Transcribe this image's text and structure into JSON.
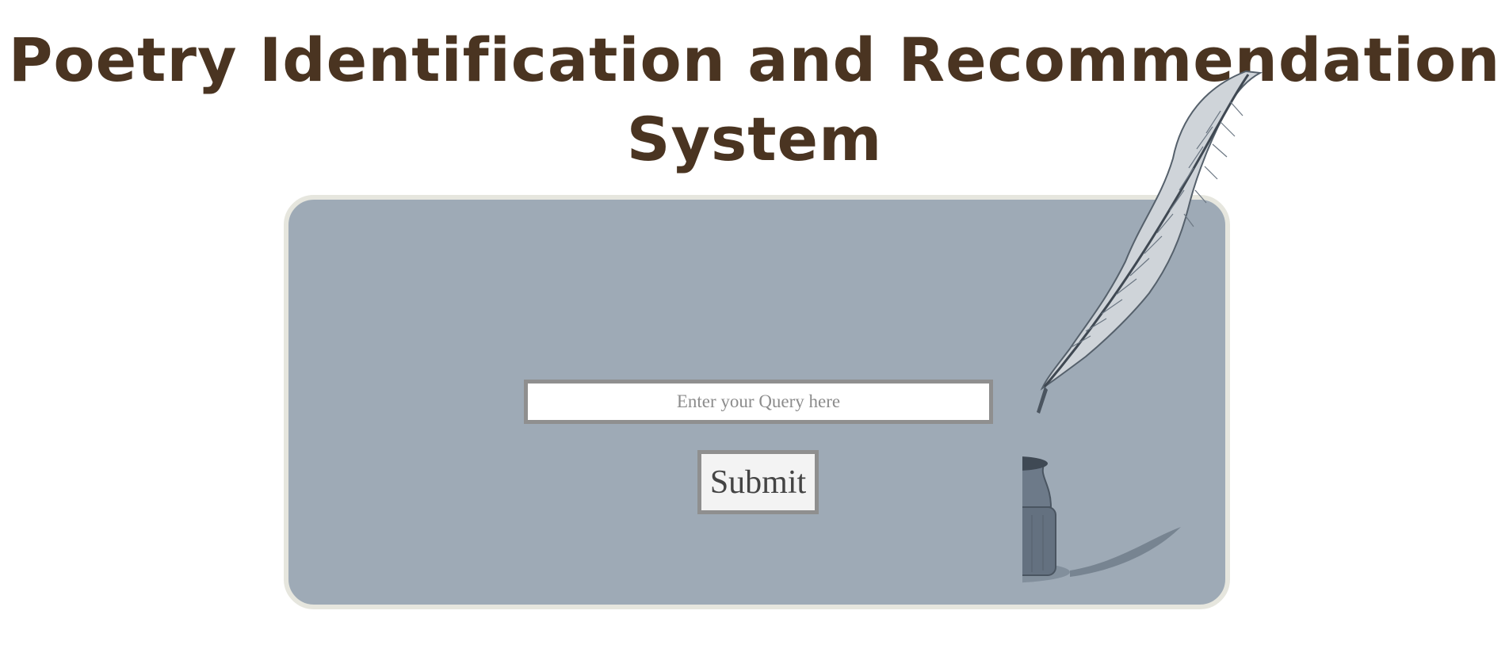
{
  "page": {
    "title": "Poetry Identification and Recommendation System"
  },
  "search": {
    "placeholder": "Enter your Query here",
    "value": ""
  },
  "submit": {
    "label": "Submit"
  },
  "colors": {
    "title_text": "#4a3421",
    "panel_background": "#9eaab6",
    "panel_border": "#e6e6de",
    "input_border": "#8f8f8f",
    "button_text": "#444444",
    "quill_ink": "#5b6a79"
  },
  "illustration": {
    "icon": "quill-and-inkwell-icon"
  }
}
